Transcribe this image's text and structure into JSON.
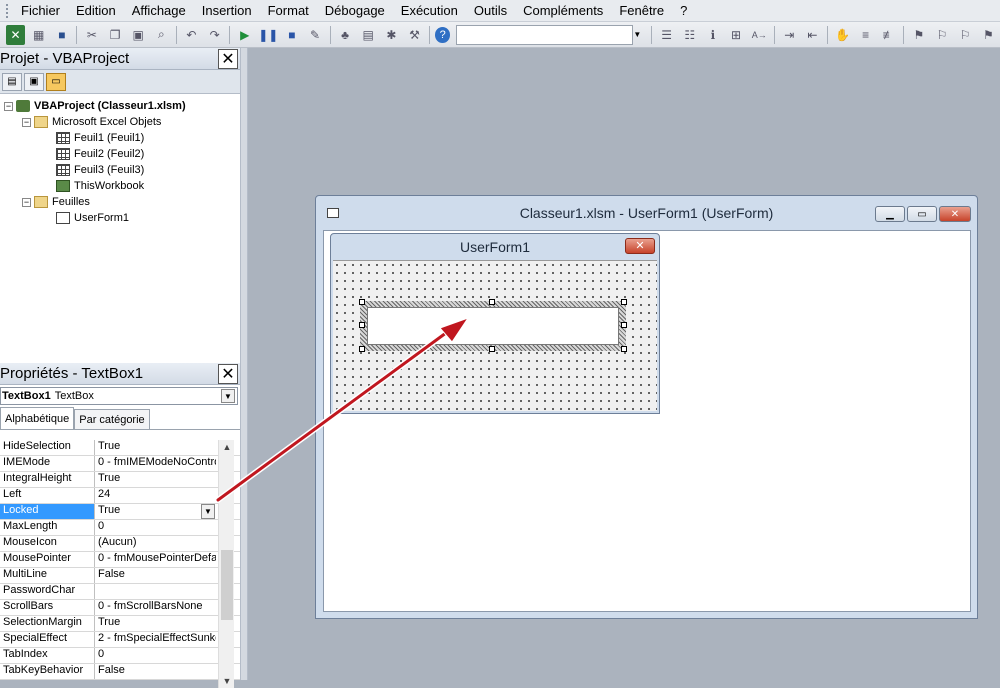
{
  "menu": [
    "Fichier",
    "Edition",
    "Affichage",
    "Insertion",
    "Format",
    "Débogage",
    "Exécution",
    "Outils",
    "Compléments",
    "Fenêtre",
    "?"
  ],
  "project_panel": {
    "title": "Projet - VBAProject",
    "tree": [
      {
        "label": "VBAProject (Classeur1.xlsm)"
      },
      {
        "label": "Microsoft Excel Objets"
      },
      {
        "label": "Feuil1 (Feuil1)"
      },
      {
        "label": "Feuil2 (Feuil2)"
      },
      {
        "label": "Feuil3 (Feuil3)"
      },
      {
        "label": "ThisWorkbook"
      },
      {
        "label": "Feuilles"
      },
      {
        "label": "UserForm1"
      }
    ]
  },
  "properties_panel": {
    "title": "Propriétés - TextBox1",
    "object_name": "TextBox1",
    "object_type": "TextBox",
    "tabs": [
      "Alphabétique",
      "Par catégorie"
    ],
    "rows": [
      {
        "name": "HideSelection",
        "value": "True"
      },
      {
        "name": "IMEMode",
        "value": "0 - fmIMEModeNoContro"
      },
      {
        "name": "IntegralHeight",
        "value": "True"
      },
      {
        "name": "Left",
        "value": "24"
      },
      {
        "name": "Locked",
        "value": "True"
      },
      {
        "name": "MaxLength",
        "value": "0"
      },
      {
        "name": "MouseIcon",
        "value": "(Aucun)"
      },
      {
        "name": "MousePointer",
        "value": "0 - fmMousePointerDefau"
      },
      {
        "name": "MultiLine",
        "value": "False"
      },
      {
        "name": "PasswordChar",
        "value": ""
      },
      {
        "name": "ScrollBars",
        "value": "0 - fmScrollBarsNone"
      },
      {
        "name": "SelectionMargin",
        "value": "True"
      },
      {
        "name": "SpecialEffect",
        "value": "2 - fmSpecialEffectSunke"
      },
      {
        "name": "TabIndex",
        "value": "0"
      },
      {
        "name": "TabKeyBehavior",
        "value": "False"
      }
    ]
  },
  "code_window": {
    "title": "Classeur1.xlsm - UserForm1 (UserForm)"
  },
  "userform": {
    "title": "UserForm1"
  },
  "colors": {
    "selection": "#3399ff",
    "arrow": "#c0171f"
  }
}
